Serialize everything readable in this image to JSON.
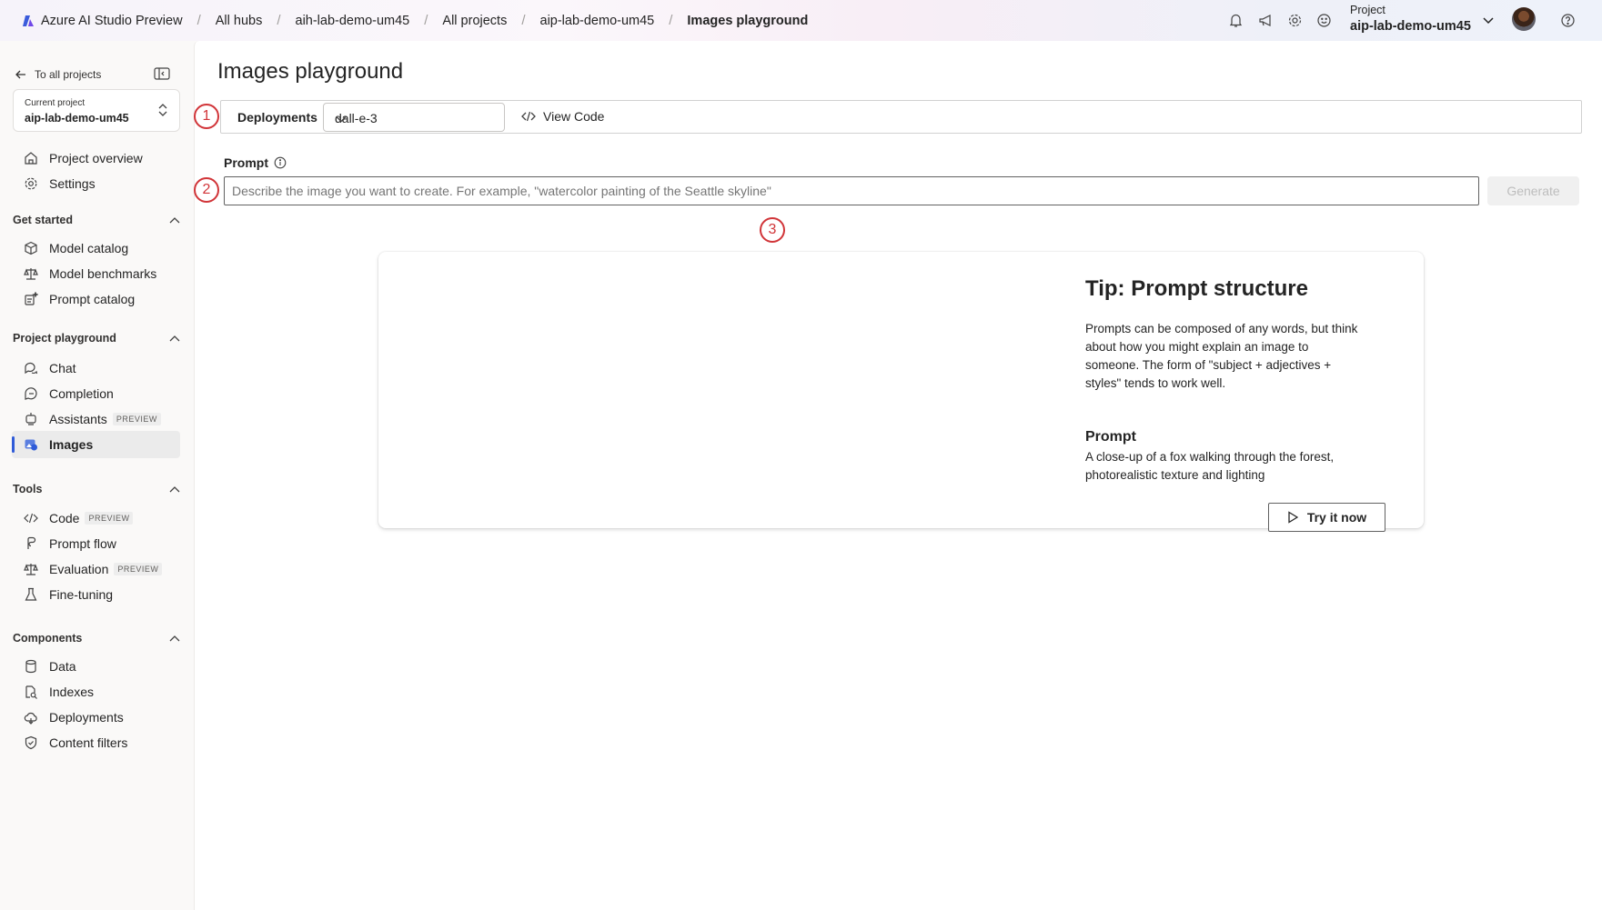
{
  "topbar": {
    "brand": "Azure AI Studio",
    "brand_suffix": " Preview",
    "breadcrumbs": [
      "All hubs",
      "aih-lab-demo-um45",
      "All projects",
      "aip-lab-demo-um45"
    ],
    "current": "Images playground",
    "project_label": "Project",
    "project_name": "aip-lab-demo-um45"
  },
  "sidebar": {
    "back": "To all projects",
    "current_project_label": "Current project",
    "current_project_name": "aip-lab-demo-um45",
    "items_top": [
      {
        "label": "Project overview",
        "icon": "home-icon"
      },
      {
        "label": "Settings",
        "icon": "gear-icon"
      }
    ],
    "sections": [
      {
        "title": "Get started",
        "items": [
          {
            "label": "Model catalog",
            "icon": "cube-icon"
          },
          {
            "label": "Model benchmarks",
            "icon": "scale-icon"
          },
          {
            "label": "Prompt catalog",
            "icon": "sparkle-doc-icon"
          }
        ]
      },
      {
        "title": "Project playground",
        "items": [
          {
            "label": "Chat",
            "icon": "chat-icon"
          },
          {
            "label": "Completion",
            "icon": "completion-icon"
          },
          {
            "label": "Assistants",
            "icon": "assistant-icon",
            "badge": "PREVIEW"
          },
          {
            "label": "Images",
            "icon": "image-icon",
            "active": true
          }
        ]
      },
      {
        "title": "Tools",
        "items": [
          {
            "label": "Code",
            "icon": "code-icon",
            "badge": "PREVIEW"
          },
          {
            "label": "Prompt flow",
            "icon": "flow-icon"
          },
          {
            "label": "Evaluation",
            "icon": "scale-icon",
            "badge": "PREVIEW"
          },
          {
            "label": "Fine-tuning",
            "icon": "beaker-icon"
          }
        ]
      },
      {
        "title": "Components",
        "items": [
          {
            "label": "Data",
            "icon": "database-icon"
          },
          {
            "label": "Indexes",
            "icon": "index-icon"
          },
          {
            "label": "Deployments",
            "icon": "cloud-icon"
          },
          {
            "label": "Content filters",
            "icon": "shield-icon"
          }
        ]
      }
    ]
  },
  "main": {
    "title": "Images playground",
    "deployments_label": "Deployments",
    "deployment_value": "dall-e-3",
    "view_code": "View Code",
    "prompt_label": "Prompt",
    "prompt_placeholder": "Describe the image you want to create. For example, \"watercolor painting of the Seattle skyline\"",
    "generate": "Generate",
    "markers": [
      "1",
      "2",
      "3"
    ],
    "tip": {
      "title": "Tip: Prompt structure",
      "text": "Prompts can be composed of any words, but think about how you might explain an image to someone. The form of \"subject + adjectives + styles\" tends to work well.",
      "prompt_heading": "Prompt",
      "prompt_example": "A close-up of a fox walking through the forest, photorealistic texture and lighting",
      "try_button": "Try it now"
    }
  },
  "colors": {
    "accent": "#2f5bd8",
    "marker": "#d13438"
  }
}
